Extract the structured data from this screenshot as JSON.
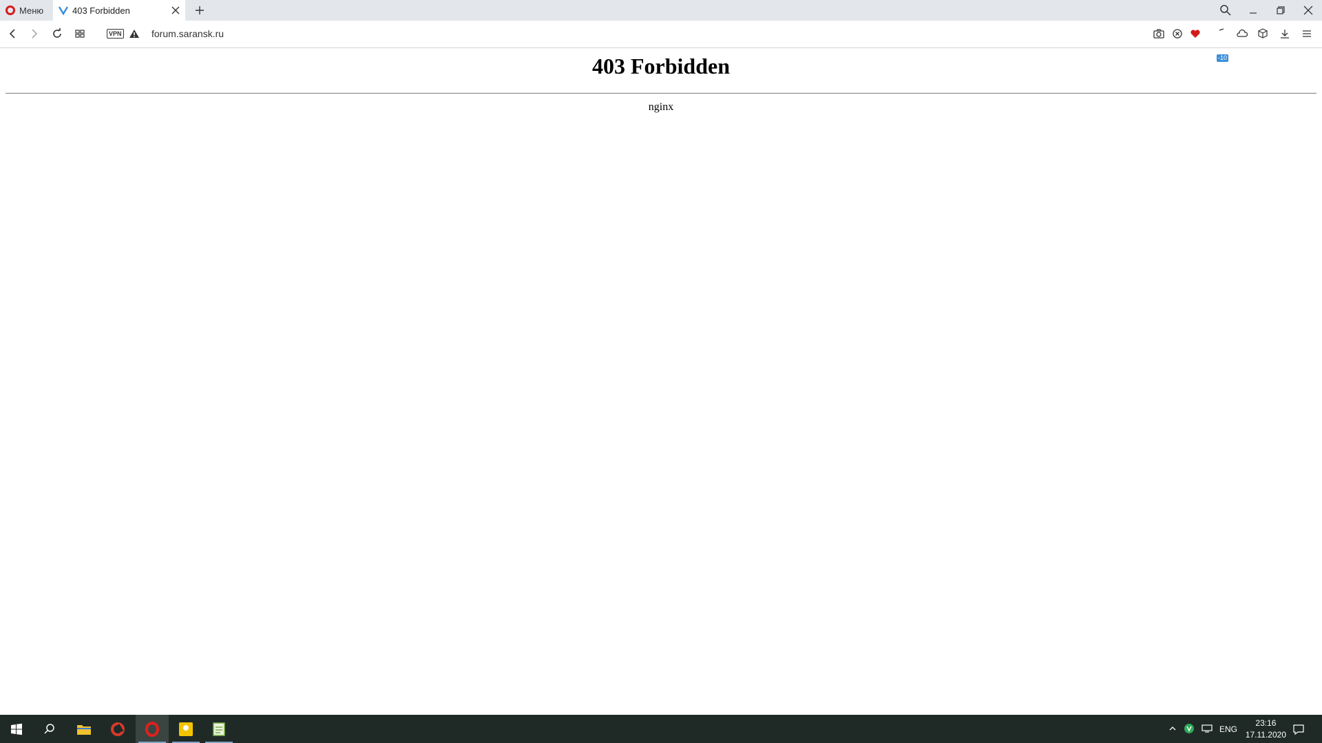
{
  "browser": {
    "menu_label": "Меню",
    "tab_title": "403 Forbidden",
    "url": "forum.saransk.ru",
    "vpn_label": "VPN",
    "badge": "-10"
  },
  "page": {
    "heading": "403 Forbidden",
    "server": "nginx"
  },
  "taskbar": {
    "language": "ENG",
    "time": "23:16",
    "date": "17.11.2020"
  }
}
